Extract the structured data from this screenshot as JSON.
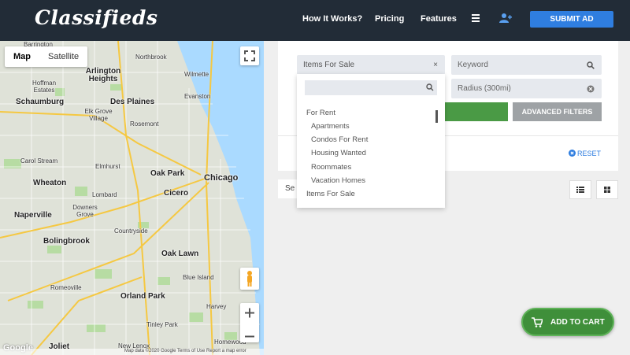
{
  "header": {
    "logo": "Classifieds",
    "nav": [
      "How It Works?",
      "Pricing",
      "Features"
    ],
    "submit_label": "SUBMIT AD"
  },
  "map": {
    "type_tabs": [
      "Map",
      "Satellite"
    ],
    "footer": "Map data ©2020 Google    Terms of Use    Report a map error",
    "google_logo": "Google",
    "labels": {
      "barrington": "Barrington",
      "northbrook": "Northbrook",
      "arlington": "Arlington Heights",
      "wilmette": "Wilmette",
      "hoffman": "Hoffman Estates",
      "schaumburg": "Schaumburg",
      "desplaines": "Des Plaines",
      "evanston": "Evanston",
      "elkgrove": "Elk Grove Village",
      "rosemont": "Rosemont",
      "carolstream": "Carol Stream",
      "elmhurst": "Elmhurst",
      "wheaton": "Wheaton",
      "oakpark": "Oak Park",
      "chicago": "Chicago",
      "lombard": "Lombard",
      "cicero": "Cicero",
      "downers": "Downers Grove",
      "naperville": "Naperville",
      "countryside": "Countryside",
      "bolingbrook": "Bolingbrook",
      "oaklawn": "Oak Lawn",
      "romeoville": "Romeoville",
      "blueisland": "Blue Island",
      "orlandpark": "Orland Park",
      "harvey": "Harvey",
      "tinleypark": "Tinley Park",
      "joliet": "Joliet",
      "homewood": "Homewood",
      "newlenox": "New Lenox"
    }
  },
  "filters": {
    "category_value": "Items For Sale",
    "keyword_placeholder": "Keyword",
    "radius_value": "Radius (300mi)",
    "advanced_label": "ADVANCED FILTERS",
    "reset_label": "RESET",
    "sort_label": "Se"
  },
  "dropdown": {
    "items": [
      "For Rent",
      "Apartments",
      "Condos For Rent",
      "Housing Wanted",
      "Roommates",
      "Vacation Homes",
      "Items For Sale"
    ]
  },
  "cart": {
    "label": "ADD TO CART"
  },
  "colors": {
    "header_bg": "#222c37",
    "brand_blue": "#2f7ee0",
    "green": "#4a9a45",
    "grey_button": "#9ea2a5"
  },
  "icons": [
    "hamburger-icon",
    "user-plus-icon",
    "search-icon",
    "clear-icon",
    "list-view-icon",
    "grid-view-icon",
    "cart-icon",
    "fullscreen-icon",
    "pegman-icon",
    "zoom-in-icon",
    "zoom-out-icon"
  ]
}
